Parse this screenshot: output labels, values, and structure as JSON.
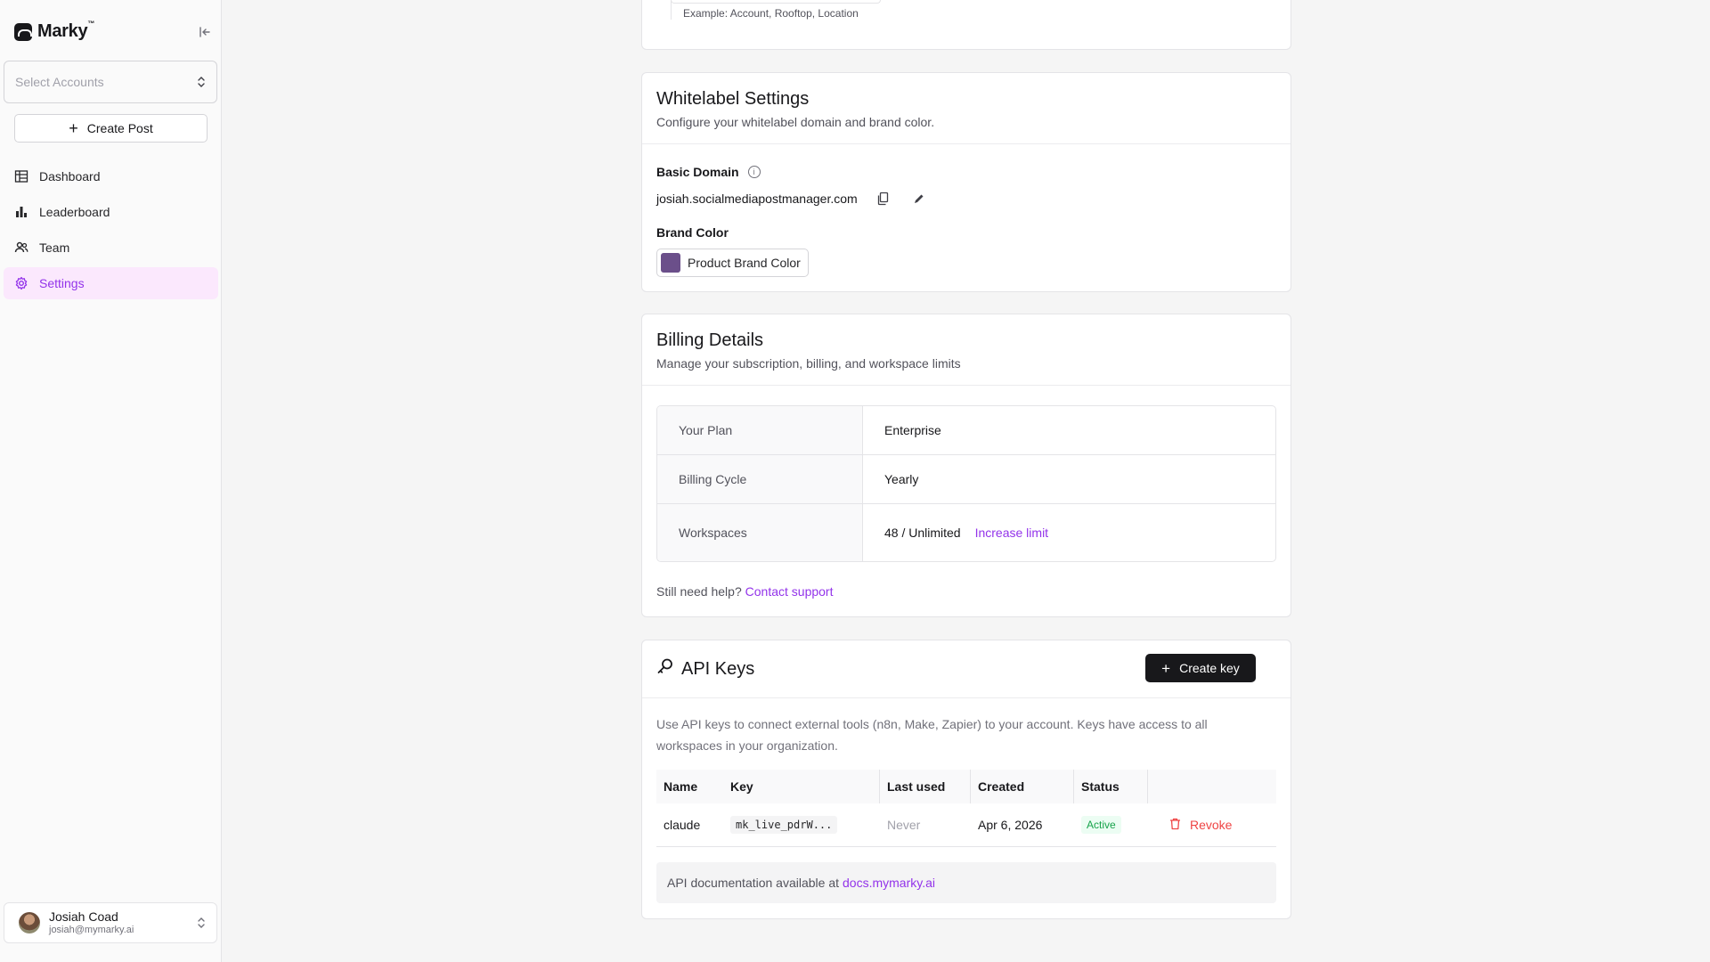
{
  "sidebar": {
    "brand": "Marky",
    "brand_tm": "™",
    "account_placeholder": "Select Accounts",
    "create_post_label": "Create Post",
    "nav": [
      {
        "label": "Dashboard",
        "icon": "grid-icon"
      },
      {
        "label": "Leaderboard",
        "icon": "bar-chart-icon"
      },
      {
        "label": "Team",
        "icon": "users-icon"
      },
      {
        "label": "Settings",
        "icon": "gear-icon",
        "active": true
      }
    ],
    "user": {
      "name": "Josiah Coad",
      "email": "josiah@mymarky.ai"
    }
  },
  "top_card": {
    "example": "Example: Account, Rooftop, Location"
  },
  "whitelabel": {
    "title": "Whitelabel Settings",
    "description": "Configure your whitelabel domain and brand color.",
    "domain_label": "Basic Domain",
    "domain_value": "josiah.socialmediapostmanager.com",
    "brand_color_label": "Brand Color",
    "brand_color_button": "Product Brand Color",
    "brand_color": "#6b4f8a"
  },
  "billing": {
    "title": "Billing Details",
    "description": "Manage your subscription, billing, and workspace limits",
    "rows": [
      {
        "label": "Your Plan",
        "value": "Enterprise"
      },
      {
        "label": "Billing Cycle",
        "value": "Yearly"
      },
      {
        "label": "Workspaces",
        "value": "48 / Unlimited",
        "link": "Increase limit"
      }
    ],
    "help_text": "Still need help?",
    "help_link": "Contact support"
  },
  "api_keys": {
    "title": "API Keys",
    "create_label": "Create key",
    "description": "Use API keys to connect external tools (n8n, Make, Zapier) to your account. Keys have access to all workspaces in your organization.",
    "columns": [
      "Name",
      "Key",
      "Last used",
      "Created",
      "Status"
    ],
    "rows": [
      {
        "name": "claude",
        "key": "mk_live_pdrW...",
        "last_used": "Never",
        "created": "Apr 6, 2026",
        "status": "Active",
        "action": "Revoke"
      }
    ],
    "docs_text": "API documentation available at",
    "docs_link": "docs.mymarky.ai"
  },
  "colors": {
    "accent": "#9333ea",
    "danger": "#ef4444",
    "success": "#16a34a"
  }
}
